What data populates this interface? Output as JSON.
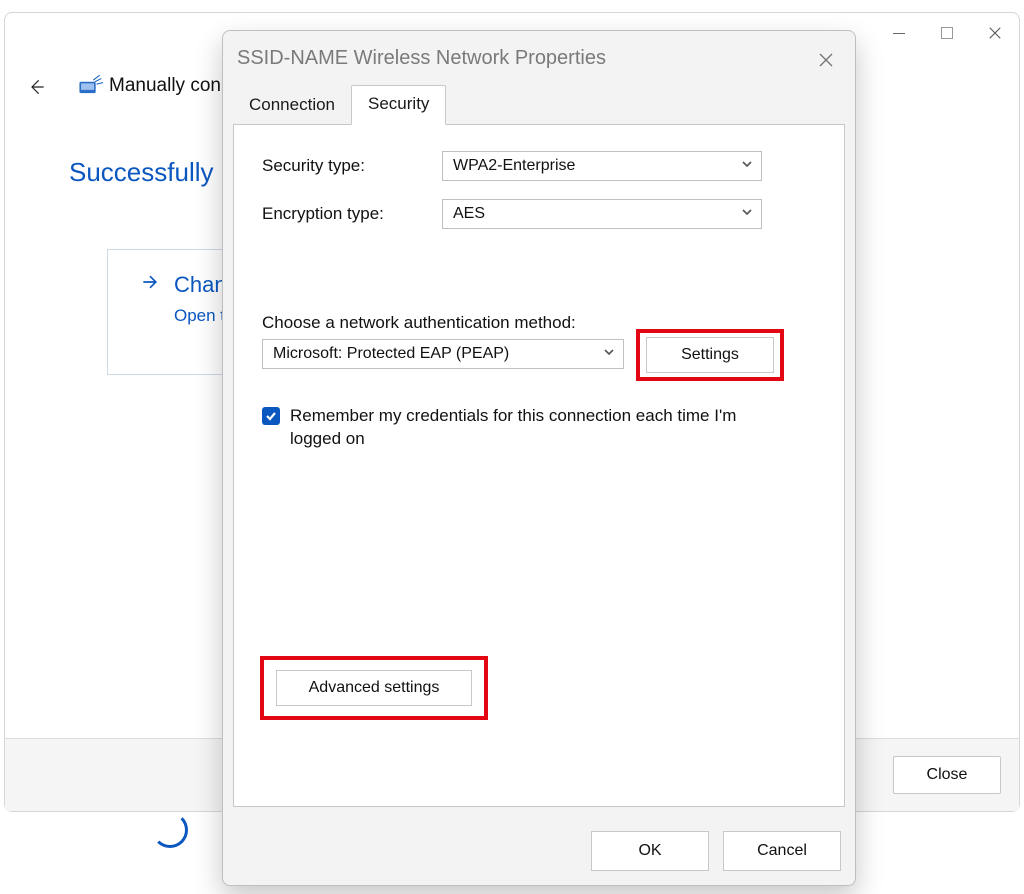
{
  "background": {
    "breadcrumb_text": "Manually con",
    "success_text": "Successfully ",
    "card_title": "Chang",
    "card_subtitle": "Open the",
    "close_button": "Close"
  },
  "dialog": {
    "title": "SSID-NAME Wireless Network Properties",
    "tabs": {
      "connection": "Connection",
      "security": "Security"
    },
    "security_type": {
      "label": "Security type:",
      "value": "WPA2-Enterprise"
    },
    "encryption_type": {
      "label": "Encryption type:",
      "value": "AES"
    },
    "auth": {
      "label": "Choose a network authentication method:",
      "value": "Microsoft: Protected EAP (PEAP)",
      "settings_button": "Settings"
    },
    "remember": {
      "checked": true,
      "text": "Remember my credentials for this connection each time I'm logged on"
    },
    "advanced_button": "Advanced settings",
    "ok": "OK",
    "cancel": "Cancel"
  }
}
